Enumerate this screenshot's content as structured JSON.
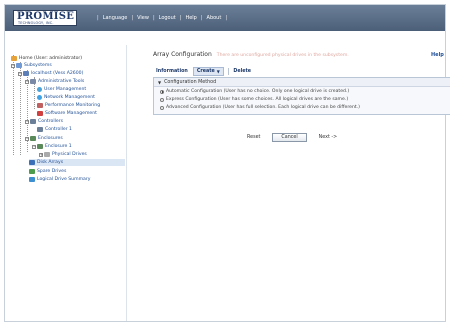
{
  "header": {
    "logo_main": "PROMISE",
    "logo_sub": "TECHNOLOGY, INC.",
    "nav": [
      "Language",
      "View",
      "Logout",
      "Help",
      "About"
    ],
    "separator": "|"
  },
  "tree": {
    "home": "Home (User: administrator)",
    "subsystems": "Subsystems",
    "host": "localhost (Vess A2600)",
    "admin_tools": "Administrative Tools",
    "user_mgmt": "User Management",
    "net_mgmt": "Network Management",
    "perf_mon": "Performance Monitoring",
    "soft_mgmt": "Software Management",
    "controllers": "Controllers",
    "controller1": "Controller 1",
    "enclosures": "Enclosures",
    "enclosure1": "Enclosure 1",
    "physical_drives": "Physical Drives",
    "disk_arrays": "Disk Arrays",
    "spare_drives": "Spare Drives",
    "logical_summary": "Logical Drive Summary"
  },
  "main": {
    "title": "Array Configuration",
    "title_note": "There are unconfigured physical drives in the subsystem.",
    "help": "Help",
    "tabs": {
      "information": "Information",
      "create": "Create",
      "delete": "Delete"
    },
    "panel_title": "Configuration Method",
    "options": [
      "Automatic Configuration (User has no choice. Only one logical drive is created.)",
      "Express Configuration (User has some choices. All logical drives are the same.)",
      "Advanced Configuration (User has full selection. Each logical drive can be different.)"
    ],
    "selected_option": 0,
    "buttons": {
      "reset": "Reset",
      "cancel": "Cancel",
      "next": "Next ->"
    }
  }
}
